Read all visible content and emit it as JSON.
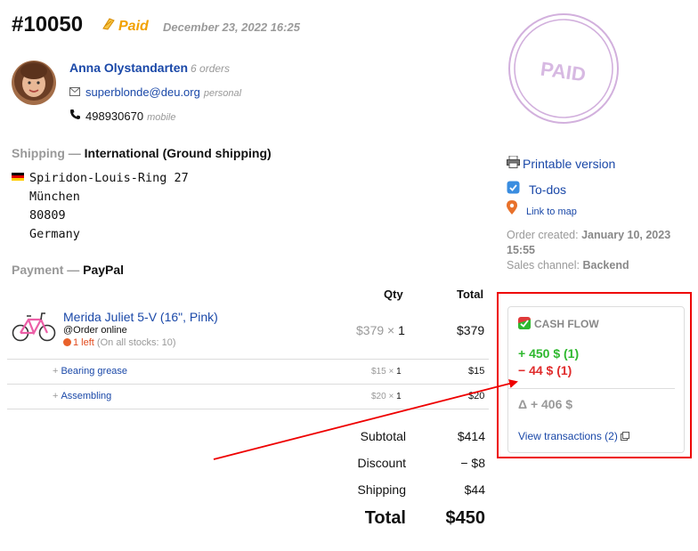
{
  "order": {
    "number": "#10050",
    "status": "Paid",
    "date": "December 23, 2022 16:25"
  },
  "customer": {
    "name": "Anna Olystandarten",
    "orders": "6 orders",
    "email": "superblonde@deu.org",
    "email_type": "personal",
    "phone": "498930670",
    "phone_type": "mobile"
  },
  "shipping": {
    "label": "Shipping",
    "method": "International (Ground shipping)",
    "address": [
      "Spiridon-Louis-Ring 27",
      "München",
      "80809",
      "Germany"
    ]
  },
  "payment": {
    "label": "Payment",
    "method": "PayPal"
  },
  "items_table": {
    "qty_header": "Qty",
    "total_header": "Total",
    "item": {
      "name": "Merida Juliet 5-V (16\", Pink)",
      "source": "@Order online",
      "stock_left": "1 left",
      "stock_all": "(On all stocks: 10)",
      "price": "$379",
      "qty": "1",
      "total": "$379"
    },
    "services": [
      {
        "name": "Bearing grease",
        "price": "$15",
        "qty": "1",
        "total": "$15"
      },
      {
        "name": "Assembling",
        "price": "$20",
        "qty": "1",
        "total": "$20"
      }
    ]
  },
  "summary": {
    "subtotal_label": "Subtotal",
    "subtotal": "$414",
    "discount_label": "Discount",
    "discount": "− $8",
    "shipping_label": "Shipping",
    "shipping": "$44",
    "total_label": "Total",
    "total": "$450"
  },
  "sidebar": {
    "stamp_text": "PAID",
    "printable": "Printable version",
    "todos": "To-dos",
    "map": "Link to map",
    "created_label": "Order created:",
    "created_value": "January 10, 2023 15:55",
    "channel_label": "Sales channel:",
    "channel_value": "Backend"
  },
  "cashflow": {
    "title": "CASH FLOW",
    "incoming": "+ 450 $ (1)",
    "outgoing": "− 44 $ (1)",
    "delta": "Δ + 406 $",
    "view_link": "View transactions (2)"
  },
  "colors": {
    "link": "#1a48a8",
    "paid": "#f2a100",
    "incoming": "#2eb82e",
    "outgoing": "#e02b2b",
    "highlight_frame": "#ee0000",
    "stamp": "#c9a0d6"
  },
  "icons": [
    "paid-icon",
    "email-icon",
    "phone-icon",
    "printer-icon",
    "todo-icon",
    "map-pin-icon",
    "cashflow-icon",
    "external-window-icon"
  ]
}
